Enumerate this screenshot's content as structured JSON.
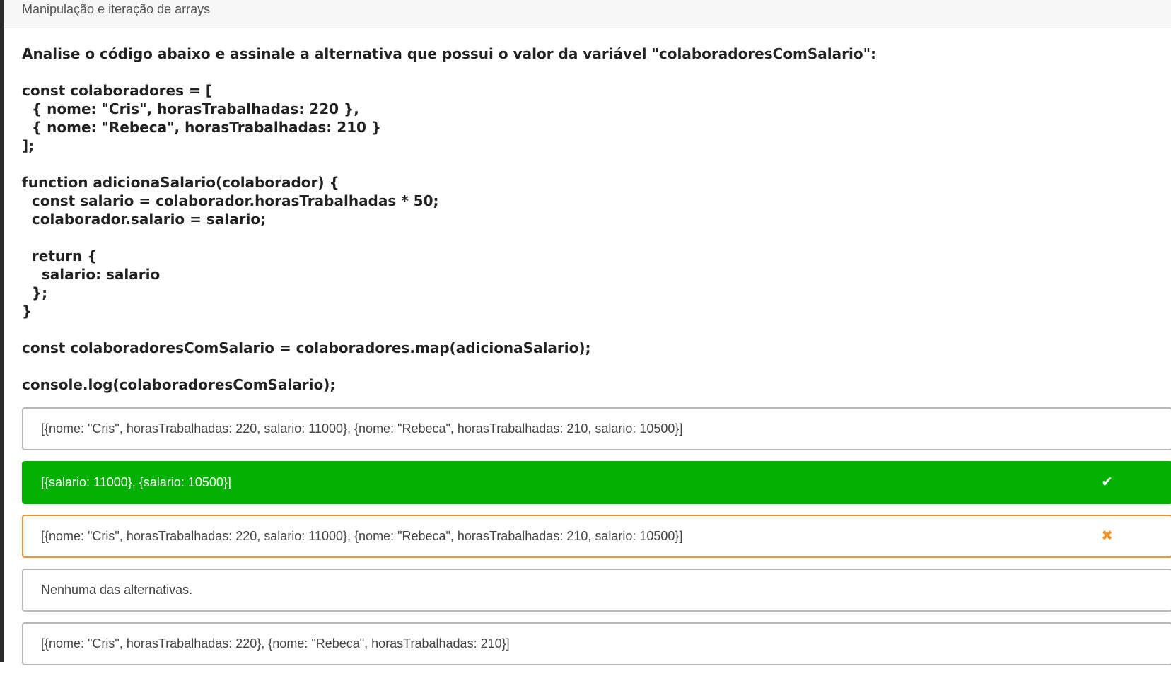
{
  "topic": {
    "title": "Manipulação e iteração de arrays"
  },
  "question": {
    "lines": [
      "Analise o código abaixo e assinale a alternativa que possui o valor da variável \"colaboradoresComSalario\":",
      "",
      "const colaboradores = [",
      "  { nome: \"Cris\", horasTrabalhadas: 220 },",
      "  { nome: \"Rebeca\", horasTrabalhadas: 210 }",
      "];",
      "",
      "function adicionaSalario(colaborador) {",
      "  const salario = colaborador.horasTrabalhadas * 50;",
      "  colaborador.salario = salario;",
      "",
      "  return {",
      "    salario: salario",
      "  };",
      "}",
      "",
      "const colaboradoresComSalario = colaboradores.map(adicionaSalario);",
      "",
      "console.log(colaboradoresComSalario);"
    ]
  },
  "options": [
    {
      "text": "[{nome: \"Cris\", horasTrabalhadas: 220, salario: 11000}, {nome: \"Rebeca\", horasTrabalhadas: 210, salario: 10500}]",
      "state": "neutral",
      "icon": ""
    },
    {
      "text": "[{salario: 11000}, {salario: 10500}]",
      "state": "correct",
      "icon": "✔"
    },
    {
      "text": "[{nome: \"Cris\", horasTrabalhadas: 220, salario: 11000}, {nome: \"Rebeca\", horasTrabalhadas: 210, salario: 10500}]",
      "state": "wrong",
      "icon": "✖"
    },
    {
      "text": "Nenhuma das alternativas.",
      "state": "neutral",
      "icon": ""
    },
    {
      "text": "[{nome: \"Cris\", horasTrabalhadas: 220}, {nome: \"Rebeca\", horasTrabalhadas: 210}]",
      "state": "neutral",
      "icon": ""
    }
  ],
  "colors": {
    "correct": "#03b003",
    "wrong": "#f0952d",
    "border": "#b8b8b8"
  }
}
